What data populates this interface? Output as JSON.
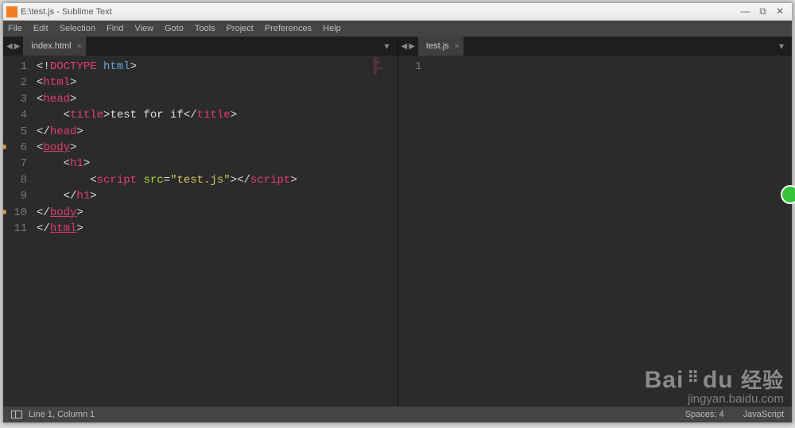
{
  "window": {
    "title": "E:\\test.js - Sublime Text"
  },
  "menubar": {
    "items": [
      "File",
      "Edit",
      "Selection",
      "Find",
      "View",
      "Goto",
      "Tools",
      "Project",
      "Preferences",
      "Help"
    ]
  },
  "panes": [
    {
      "tab": {
        "label": "index.html"
      },
      "lines": 11,
      "markers": [
        6,
        10
      ],
      "code_tokens": [
        [
          {
            "c": "p",
            "t": "<!"
          },
          {
            "c": "kw",
            "t": "DOCTYPE"
          },
          {
            "c": "p",
            "t": " "
          },
          {
            "c": "ht",
            "t": "html"
          },
          {
            "c": "p",
            "t": ">"
          }
        ],
        [
          {
            "c": "p",
            "t": "<"
          },
          {
            "c": "tg",
            "t": "html"
          },
          {
            "c": "p",
            "t": ">"
          }
        ],
        [
          {
            "c": "p",
            "t": "<"
          },
          {
            "c": "tg",
            "t": "head"
          },
          {
            "c": "p",
            "t": ">"
          }
        ],
        [
          {
            "c": "p",
            "t": "    <"
          },
          {
            "c": "tg",
            "t": "title"
          },
          {
            "c": "p",
            "t": ">"
          },
          {
            "c": "tx",
            "t": "test for if"
          },
          {
            "c": "p",
            "t": "</"
          },
          {
            "c": "tg",
            "t": "title"
          },
          {
            "c": "p",
            "t": ">"
          }
        ],
        [
          {
            "c": "p",
            "t": "</"
          },
          {
            "c": "tg",
            "t": "head"
          },
          {
            "c": "p",
            "t": ">"
          }
        ],
        [
          {
            "c": "p",
            "t": "<"
          },
          {
            "c": "tg underline",
            "t": "body"
          },
          {
            "c": "p",
            "t": ">"
          }
        ],
        [
          {
            "c": "p",
            "t": "    <"
          },
          {
            "c": "tg",
            "t": "h1"
          },
          {
            "c": "p",
            "t": ">"
          }
        ],
        [
          {
            "c": "p",
            "t": "        <"
          },
          {
            "c": "tg",
            "t": "script"
          },
          {
            "c": "p",
            "t": " "
          },
          {
            "c": "at",
            "t": "src"
          },
          {
            "c": "p",
            "t": "="
          },
          {
            "c": "st",
            "t": "\"test.js\""
          },
          {
            "c": "p",
            "t": "></"
          },
          {
            "c": "tg",
            "t": "script"
          },
          {
            "c": "p",
            "t": ">"
          }
        ],
        [
          {
            "c": "p",
            "t": "    </"
          },
          {
            "c": "tg",
            "t": "h1"
          },
          {
            "c": "p",
            "t": ">"
          }
        ],
        [
          {
            "c": "p",
            "t": "</"
          },
          {
            "c": "tg underline",
            "t": "body"
          },
          {
            "c": "p",
            "t": ">"
          }
        ],
        [
          {
            "c": "p",
            "t": "</"
          },
          {
            "c": "tg underline",
            "t": "html"
          },
          {
            "c": "p",
            "t": ">"
          }
        ]
      ]
    },
    {
      "tab": {
        "label": "test.js"
      },
      "lines": 1,
      "markers": [],
      "code_tokens": [
        []
      ]
    }
  ],
  "statusbar": {
    "position": "Line 1, Column 1",
    "spaces": "Spaces: 4",
    "syntax": "JavaScript"
  },
  "watermark": {
    "brand_a": "Bai",
    "brand_b": "du",
    "brand_cn": "经验",
    "sub": "jingyan.baidu.com"
  }
}
